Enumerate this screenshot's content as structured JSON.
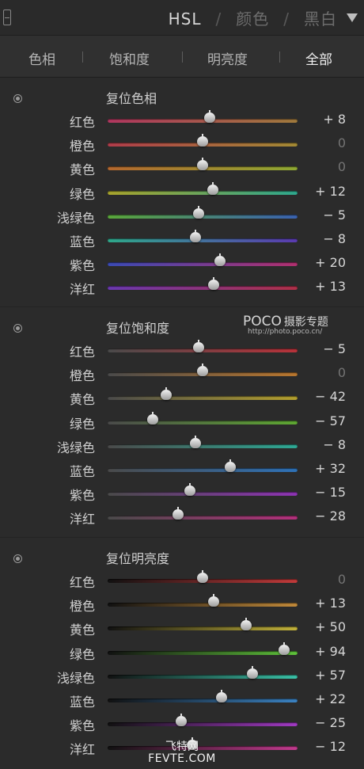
{
  "header": {
    "nav": [
      "HSL",
      "颜色",
      "黑白"
    ],
    "separator": "/",
    "active_index": 0,
    "collapse_icon": "triangle-down-icon",
    "panel_icon": "panel-toggle-icon"
  },
  "tabs": {
    "items": [
      "色相",
      "饱和度",
      "明亮度",
      "全部"
    ],
    "active_index": 3
  },
  "sections": [
    {
      "title": "复位色相",
      "reset_icon": "reset-target-icon",
      "rows": [
        {
          "label": "红色",
          "value": "+ 8",
          "num": 8,
          "colors": [
            "#b0365f",
            "#a07a3c"
          ]
        },
        {
          "label": "橙色",
          "value": "0",
          "num": 0,
          "colors": [
            "#b03c4a",
            "#a38a34"
          ]
        },
        {
          "label": "黄色",
          "value": "0",
          "num": 0,
          "colors": [
            "#b4672e",
            "#8ea832"
          ]
        },
        {
          "label": "绿色",
          "value": "+ 12",
          "num": 12,
          "colors": [
            "#a8a42c",
            "#2ea88e"
          ]
        },
        {
          "label": "浅绿色",
          "value": "− 5",
          "num": -5,
          "colors": [
            "#5aa83a",
            "#3a62b0"
          ]
        },
        {
          "label": "蓝色",
          "value": "− 8",
          "num": -8,
          "colors": [
            "#2ea88a",
            "#5a3ab0"
          ]
        },
        {
          "label": "紫色",
          "value": "+ 20",
          "num": 20,
          "colors": [
            "#3a4ab4",
            "#b0306e"
          ]
        },
        {
          "label": "洋红",
          "value": "+ 13",
          "num": 13,
          "colors": [
            "#6a38b0",
            "#b03048"
          ]
        }
      ]
    },
    {
      "title": "复位饱和度",
      "reset_icon": "reset-target-icon",
      "rows": [
        {
          "label": "红色",
          "value": "− 5",
          "num": -5,
          "colors": [
            "#4a4a4a",
            "#b8323a"
          ]
        },
        {
          "label": "橙色",
          "value": "0",
          "num": 0,
          "colors": [
            "#4a4a4a",
            "#b8762e"
          ]
        },
        {
          "label": "黄色",
          "value": "− 42",
          "num": -42,
          "colors": [
            "#4a4a4a",
            "#b4a02e"
          ]
        },
        {
          "label": "绿色",
          "value": "− 57",
          "num": -57,
          "colors": [
            "#4a4a4a",
            "#5ea832"
          ]
        },
        {
          "label": "浅绿色",
          "value": "− 8",
          "num": -8,
          "colors": [
            "#4a4a4a",
            "#2ea894"
          ]
        },
        {
          "label": "蓝色",
          "value": "+ 32",
          "num": 32,
          "colors": [
            "#4a4a4a",
            "#2e72b8"
          ]
        },
        {
          "label": "紫色",
          "value": "− 15",
          "num": -15,
          "colors": [
            "#4a4a4a",
            "#8e34b4"
          ]
        },
        {
          "label": "洋红",
          "value": "− 28",
          "num": -28,
          "colors": [
            "#4a4a4a",
            "#b4307c"
          ]
        }
      ]
    },
    {
      "title": "复位明亮度",
      "reset_icon": "reset-target-icon",
      "rows": [
        {
          "label": "红色",
          "value": "0",
          "num": 0,
          "colors": [
            "#111111",
            "#c23a3a"
          ]
        },
        {
          "label": "橙色",
          "value": "+ 13",
          "num": 13,
          "colors": [
            "#111111",
            "#c28a3a"
          ]
        },
        {
          "label": "黄色",
          "value": "+ 50",
          "num": 50,
          "colors": [
            "#111111",
            "#c2b23a"
          ]
        },
        {
          "label": "绿色",
          "value": "+ 94",
          "num": 94,
          "colors": [
            "#111111",
            "#5ec23a"
          ]
        },
        {
          "label": "浅绿色",
          "value": "+ 57",
          "num": 57,
          "colors": [
            "#111111",
            "#3ac2a8"
          ]
        },
        {
          "label": "蓝色",
          "value": "+ 22",
          "num": 22,
          "colors": [
            "#111111",
            "#3a82c2"
          ]
        },
        {
          "label": "紫色",
          "value": "− 25",
          "num": -25,
          "colors": [
            "#111111",
            "#a03ac2"
          ]
        },
        {
          "label": "洋红",
          "value": "− 12",
          "num": -12,
          "colors": [
            "#111111",
            "#c23a8e"
          ]
        }
      ]
    }
  ],
  "watermark": {
    "logo": "POCO",
    "logo_cn": "摄影专题",
    "url": "http://photo.poco.cn/"
  },
  "site_mark": {
    "cn": "飞特网",
    "en": "FEVTE.COM"
  }
}
